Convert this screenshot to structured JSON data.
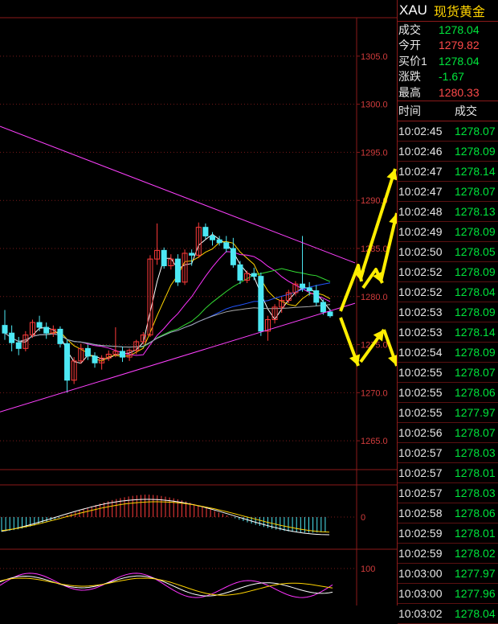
{
  "quote": {
    "symbol": "XAU",
    "name": "现货黄金",
    "rows": [
      {
        "label": "成交",
        "value": "1278.04",
        "color": "#00e63c"
      },
      {
        "label": "今开",
        "value": "1279.82",
        "color": "#ff4a4a"
      },
      {
        "label": "买价1",
        "value": "1278.04",
        "color": "#00e63c"
      },
      {
        "label": "涨跌",
        "value": "-1.67",
        "color": "#00e63c"
      },
      {
        "label": "最高",
        "value": "1280.33",
        "color": "#ff4a4a"
      }
    ]
  },
  "ticks_header": {
    "time": "时间",
    "price": "成交"
  },
  "ticks": [
    {
      "time": "10:02:45",
      "price": "1278.07"
    },
    {
      "time": "10:02:46",
      "price": "1278.09"
    },
    {
      "time": "10:02:47",
      "price": "1278.14"
    },
    {
      "time": "10:02:47",
      "price": "1278.07"
    },
    {
      "time": "10:02:48",
      "price": "1278.13"
    },
    {
      "time": "10:02:49",
      "price": "1278.09"
    },
    {
      "time": "10:02:50",
      "price": "1278.05"
    },
    {
      "time": "10:02:52",
      "price": "1278.09"
    },
    {
      "time": "10:02:52",
      "price": "1278.04"
    },
    {
      "time": "10:02:53",
      "price": "1278.09"
    },
    {
      "time": "10:02:53",
      "price": "1278.14"
    },
    {
      "time": "10:02:54",
      "price": "1278.09"
    },
    {
      "time": "10:02:55",
      "price": "1278.07"
    },
    {
      "time": "10:02:55",
      "price": "1278.06"
    },
    {
      "time": "10:02:55",
      "price": "1277.97"
    },
    {
      "time": "10:02:56",
      "price": "1278.07"
    },
    {
      "time": "10:02:57",
      "price": "1278.03"
    },
    {
      "time": "10:02:57",
      "price": "1278.01"
    },
    {
      "time": "10:02:57",
      "price": "1278.03"
    },
    {
      "time": "10:02:58",
      "price": "1278.06"
    },
    {
      "time": "10:02:59",
      "price": "1278.01"
    },
    {
      "time": "10:02:59",
      "price": "1278.02"
    },
    {
      "time": "10:03:00",
      "price": "1277.97"
    },
    {
      "time": "10:03:00",
      "price": "1277.96"
    },
    {
      "time": "10:03:02",
      "price": "1278.04"
    }
  ],
  "chart_data": {
    "type": "candlestick",
    "price_axis": {
      "ticks": [
        "1305.0",
        "1300.0",
        "1295.0",
        "1290.0",
        "1285.0",
        "1280.0",
        "1275.0",
        "1270.0",
        "1265.0"
      ],
      "range": [
        1262,
        1309
      ]
    },
    "macd_axis": {
      "ticks": [
        "0"
      ]
    },
    "kdj_axis": {
      "ticks": [
        "100"
      ]
    },
    "candles": [
      {
        "o": 1277.0,
        "h": 1278.6,
        "l": 1275.5,
        "c": 1276.2
      },
      {
        "o": 1276.2,
        "h": 1277.0,
        "l": 1274.3,
        "c": 1275.2
      },
      {
        "o": 1275.2,
        "h": 1275.8,
        "l": 1273.9,
        "c": 1274.6
      },
      {
        "o": 1274.6,
        "h": 1276.4,
        "l": 1274.3,
        "c": 1276.0
      },
      {
        "o": 1276.0,
        "h": 1277.6,
        "l": 1275.7,
        "c": 1277.3
      },
      {
        "o": 1277.3,
        "h": 1278.0,
        "l": 1276.4,
        "c": 1276.8
      },
      {
        "o": 1276.8,
        "h": 1277.3,
        "l": 1275.6,
        "c": 1276.2
      },
      {
        "o": 1276.2,
        "h": 1277.0,
        "l": 1275.8,
        "c": 1276.6
      },
      {
        "o": 1276.6,
        "h": 1276.9,
        "l": 1274.7,
        "c": 1275.1
      },
      {
        "o": 1275.1,
        "h": 1275.5,
        "l": 1270.0,
        "c": 1271.3
      },
      {
        "o": 1271.3,
        "h": 1273.7,
        "l": 1270.9,
        "c": 1273.3
      },
      {
        "o": 1273.3,
        "h": 1275.1,
        "l": 1273.0,
        "c": 1274.6
      },
      {
        "o": 1274.6,
        "h": 1275.0,
        "l": 1273.4,
        "c": 1273.8
      },
      {
        "o": 1273.8,
        "h": 1274.2,
        "l": 1272.6,
        "c": 1273.1
      },
      {
        "o": 1273.1,
        "h": 1273.9,
        "l": 1272.4,
        "c": 1273.6
      },
      {
        "o": 1273.6,
        "h": 1274.4,
        "l": 1273.3,
        "c": 1274.0
      },
      {
        "o": 1274.0,
        "h": 1276.8,
        "l": 1273.7,
        "c": 1274.3
      },
      {
        "o": 1274.3,
        "h": 1274.8,
        "l": 1273.2,
        "c": 1273.7
      },
      {
        "o": 1273.7,
        "h": 1274.6,
        "l": 1273.3,
        "c": 1274.4
      },
      {
        "o": 1274.4,
        "h": 1275.5,
        "l": 1274.0,
        "c": 1275.3
      },
      {
        "o": 1275.3,
        "h": 1276.3,
        "l": 1275.0,
        "c": 1276.0
      },
      {
        "o": 1276.0,
        "h": 1284.3,
        "l": 1275.8,
        "c": 1283.9
      },
      {
        "o": 1283.9,
        "h": 1287.6,
        "l": 1283.3,
        "c": 1284.8
      },
      {
        "o": 1284.8,
        "h": 1285.1,
        "l": 1282.9,
        "c": 1283.2
      },
      {
        "o": 1283.2,
        "h": 1284.4,
        "l": 1282.8,
        "c": 1283.9
      },
      {
        "o": 1283.9,
        "h": 1284.4,
        "l": 1281.1,
        "c": 1281.5
      },
      {
        "o": 1281.5,
        "h": 1284.9,
        "l": 1281.2,
        "c": 1284.5
      },
      {
        "o": 1284.5,
        "h": 1284.9,
        "l": 1283.2,
        "c": 1284.3
      },
      {
        "o": 1284.3,
        "h": 1287.7,
        "l": 1284.0,
        "c": 1287.2
      },
      {
        "o": 1287.2,
        "h": 1287.6,
        "l": 1286.0,
        "c": 1286.3
      },
      {
        "o": 1286.3,
        "h": 1286.7,
        "l": 1285.3,
        "c": 1285.9
      },
      {
        "o": 1285.9,
        "h": 1286.3,
        "l": 1285.3,
        "c": 1285.6
      },
      {
        "o": 1285.6,
        "h": 1286.3,
        "l": 1284.6,
        "c": 1285.0
      },
      {
        "o": 1285.0,
        "h": 1286.1,
        "l": 1283.0,
        "c": 1283.3
      },
      {
        "o": 1283.3,
        "h": 1283.7,
        "l": 1281.3,
        "c": 1281.7
      },
      {
        "o": 1281.7,
        "h": 1282.7,
        "l": 1281.4,
        "c": 1282.4
      },
      {
        "o": 1282.4,
        "h": 1283.0,
        "l": 1281.7,
        "c": 1282.1
      },
      {
        "o": 1282.1,
        "h": 1282.5,
        "l": 1275.9,
        "c": 1276.4
      },
      {
        "o": 1276.4,
        "h": 1278.0,
        "l": 1275.4,
        "c": 1277.6
      },
      {
        "o": 1277.6,
        "h": 1279.2,
        "l": 1277.2,
        "c": 1278.9
      },
      {
        "o": 1278.9,
        "h": 1280.0,
        "l": 1278.3,
        "c": 1279.6
      },
      {
        "o": 1279.6,
        "h": 1280.7,
        "l": 1279.3,
        "c": 1280.4
      },
      {
        "o": 1280.4,
        "h": 1281.6,
        "l": 1280.1,
        "c": 1281.3
      },
      {
        "o": 1281.3,
        "h": 1286.3,
        "l": 1280.5,
        "c": 1280.9
      },
      {
        "o": 1280.9,
        "h": 1281.5,
        "l": 1280.1,
        "c": 1280.6
      },
      {
        "o": 1280.6,
        "h": 1281.2,
        "l": 1279.0,
        "c": 1279.4
      },
      {
        "o": 1279.4,
        "h": 1279.7,
        "l": 1278.1,
        "c": 1278.4
      },
      {
        "o": 1278.4,
        "h": 1278.7,
        "l": 1277.8,
        "c": 1278.0
      }
    ]
  }
}
